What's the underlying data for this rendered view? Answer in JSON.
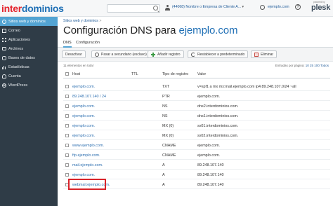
{
  "brand": {
    "part1": "inter",
    "part2": "dominios"
  },
  "topbar": {
    "user": "(44068) Nombre o Empresa de Cliente A...",
    "domain": "ejemplo.com",
    "powered_by": "powered by",
    "plesk": "plesk"
  },
  "sidebar": {
    "items": [
      {
        "label": "Sitios web y dominios",
        "icon": "globe-icon",
        "active": true
      },
      {
        "label": "Correo",
        "icon": "mail-icon"
      },
      {
        "label": "Aplicaciones",
        "icon": "apps-icon"
      },
      {
        "label": "Archivos",
        "icon": "folder-icon"
      },
      {
        "label": "Bases de datos",
        "icon": "database-icon"
      },
      {
        "label": "Estadísticas",
        "icon": "stats-icon"
      },
      {
        "label": "Cuenta",
        "icon": "user-icon"
      },
      {
        "label": "WordPress",
        "icon": "wordpress-icon"
      }
    ]
  },
  "breadcrumb": {
    "item1": "Sitios web y dominios",
    "sep": ">"
  },
  "page": {
    "title_prefix": "Configuración DNS para ",
    "title_domain": "ejemplo.com"
  },
  "tabs": [
    {
      "label": "DNS",
      "active": true
    },
    {
      "label": "Configuración"
    }
  ],
  "toolbar": {
    "deactivate": "Desactivar",
    "secondary": "Pasar a secundario (esclavo)",
    "add": "Añadir registro",
    "reset": "Restablecer a predeterminado",
    "delete": "Eliminar"
  },
  "list_meta": {
    "count": "11 elementos en total",
    "per_page_label": "Entradas por página:",
    "per_page_options": "10 25 100 Todos"
  },
  "table": {
    "columns": {
      "host": "Host",
      "ttl": "TTL",
      "type": "Tipo de registro",
      "value": "Valor"
    },
    "rows": [
      {
        "host": "ejemplo.com.",
        "type": "TXT",
        "value": "v=spf1 a mx mx:mail.ejemplo.com ip4:89.248.107.0/24 ~all"
      },
      {
        "host": "89.248.107.140 / 24",
        "type": "PTR",
        "value": "ejemplo.com."
      },
      {
        "host": "ejemplo.com.",
        "type": "NS",
        "value": "dns2.interdominios.com."
      },
      {
        "host": "ejemplo.com.",
        "type": "NS",
        "value": "dns1.interdominios.com."
      },
      {
        "host": "ejemplo.com.",
        "type": "MX (0)",
        "value": "sx01.interdominios.com."
      },
      {
        "host": "ejemplo.com.",
        "type": "MX (0)",
        "value": "sx02.interdominios.com."
      },
      {
        "host": "www.ejemplo.com.",
        "type": "CNAME",
        "value": "ejemplo.com."
      },
      {
        "host": "ftp.ejemplo.com.",
        "type": "CNAME",
        "value": "ejemplo.com."
      },
      {
        "host": "mail.ejemplo.com.",
        "type": "A",
        "value": "89.248.107.140"
      },
      {
        "host": "ejemplo.com.",
        "type": "A",
        "value": "89.248.107.140"
      },
      {
        "host": "webmail.ejemplo.com.",
        "type": "A",
        "value": "89.248.107.140"
      }
    ]
  },
  "colors": {
    "sidebar_bg": "#2f3c47",
    "sidebar_active": "#53a4d3",
    "link": "#2d6fb0",
    "highlight": "#d8232a"
  }
}
